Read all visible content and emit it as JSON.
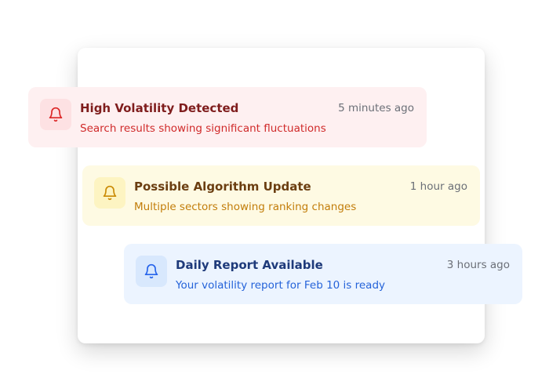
{
  "notifications": [
    {
      "title": "High Volatility Detected",
      "message": "Search results showing significant fluctuations",
      "time": "5 minutes ago",
      "icon": "bell-icon",
      "accent": "#dc2626"
    },
    {
      "title": "Possible Algorithm Update",
      "message": "Multiple sectors showing ranking changes",
      "time": "1 hour ago",
      "icon": "bell-icon",
      "accent": "#ca8a04"
    },
    {
      "title": "Daily Report Available",
      "message": "Your volatility report for Feb 10 is ready",
      "time": "3 hours ago",
      "icon": "bell-icon",
      "accent": "#2563eb"
    }
  ]
}
